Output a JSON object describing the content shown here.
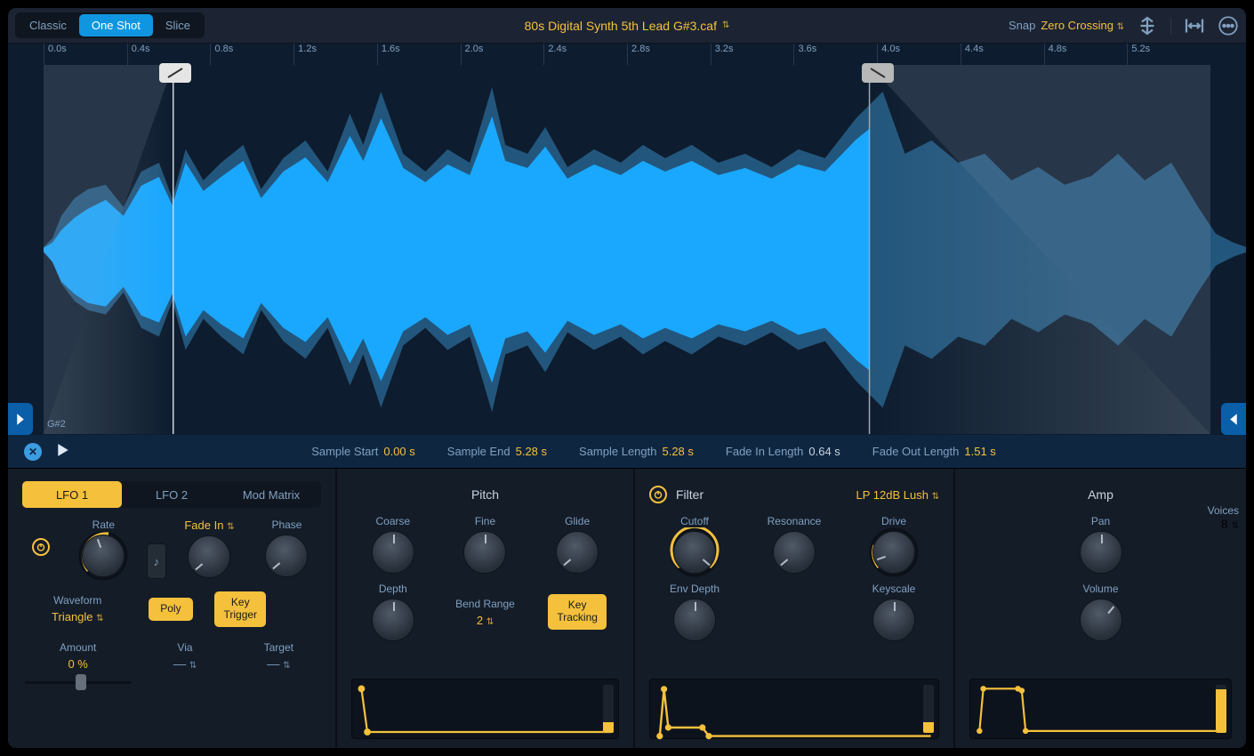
{
  "tabs": [
    "Classic",
    "One Shot",
    "Slice"
  ],
  "active_tab": 1,
  "file_name": "80s Digital Synth 5th Lead G#3.caf",
  "snap": {
    "label": "Snap",
    "value": "Zero Crossing"
  },
  "ruler": [
    "0.0s",
    "0.4s",
    "0.8s",
    "1.2s",
    "1.6s",
    "2.0s",
    "2.4s",
    "2.8s",
    "3.2s",
    "3.6s",
    "4.0s",
    "4.4s",
    "4.8s",
    "5.2s"
  ],
  "root_note": "G#2",
  "info": [
    {
      "label": "Sample Start",
      "value": "0.00 s",
      "ylw": true
    },
    {
      "label": "Sample End",
      "value": "5.28 s",
      "ylw": true
    },
    {
      "label": "Sample Length",
      "value": "5.28 s",
      "ylw": true
    },
    {
      "label": "Fade In Length",
      "value": "0.64 s",
      "ylw": false
    },
    {
      "label": "Fade Out Length",
      "value": "1.51 s",
      "ylw": true
    }
  ],
  "lfo": {
    "tabs": [
      "LFO 1",
      "LFO 2",
      "Mod Matrix"
    ],
    "active": 0,
    "rate_label": "Rate",
    "fade_label": "Fade In",
    "phase_label": "Phase",
    "waveform_label": "Waveform",
    "waveform_value": "Triangle",
    "poly": "Poly",
    "key_trigger": "Key\nTrigger",
    "amount_label": "Amount",
    "amount_value": "0 %",
    "via_label": "Via",
    "via_value": "––",
    "target_label": "Target",
    "target_value": "––"
  },
  "pitch": {
    "title": "Pitch",
    "coarse": "Coarse",
    "fine": "Fine",
    "glide": "Glide",
    "depth": "Depth",
    "bend_label": "Bend Range",
    "bend_value": "2",
    "key_tracking": "Key\nTracking"
  },
  "filter": {
    "title": "Filter",
    "type": "LP 12dB Lush",
    "cutoff": "Cutoff",
    "resonance": "Resonance",
    "drive": "Drive",
    "env_depth": "Env Depth",
    "keyscale": "Keyscale"
  },
  "amp": {
    "title": "Amp",
    "pan": "Pan",
    "volume": "Volume",
    "voices_label": "Voices",
    "voices_value": "8"
  }
}
